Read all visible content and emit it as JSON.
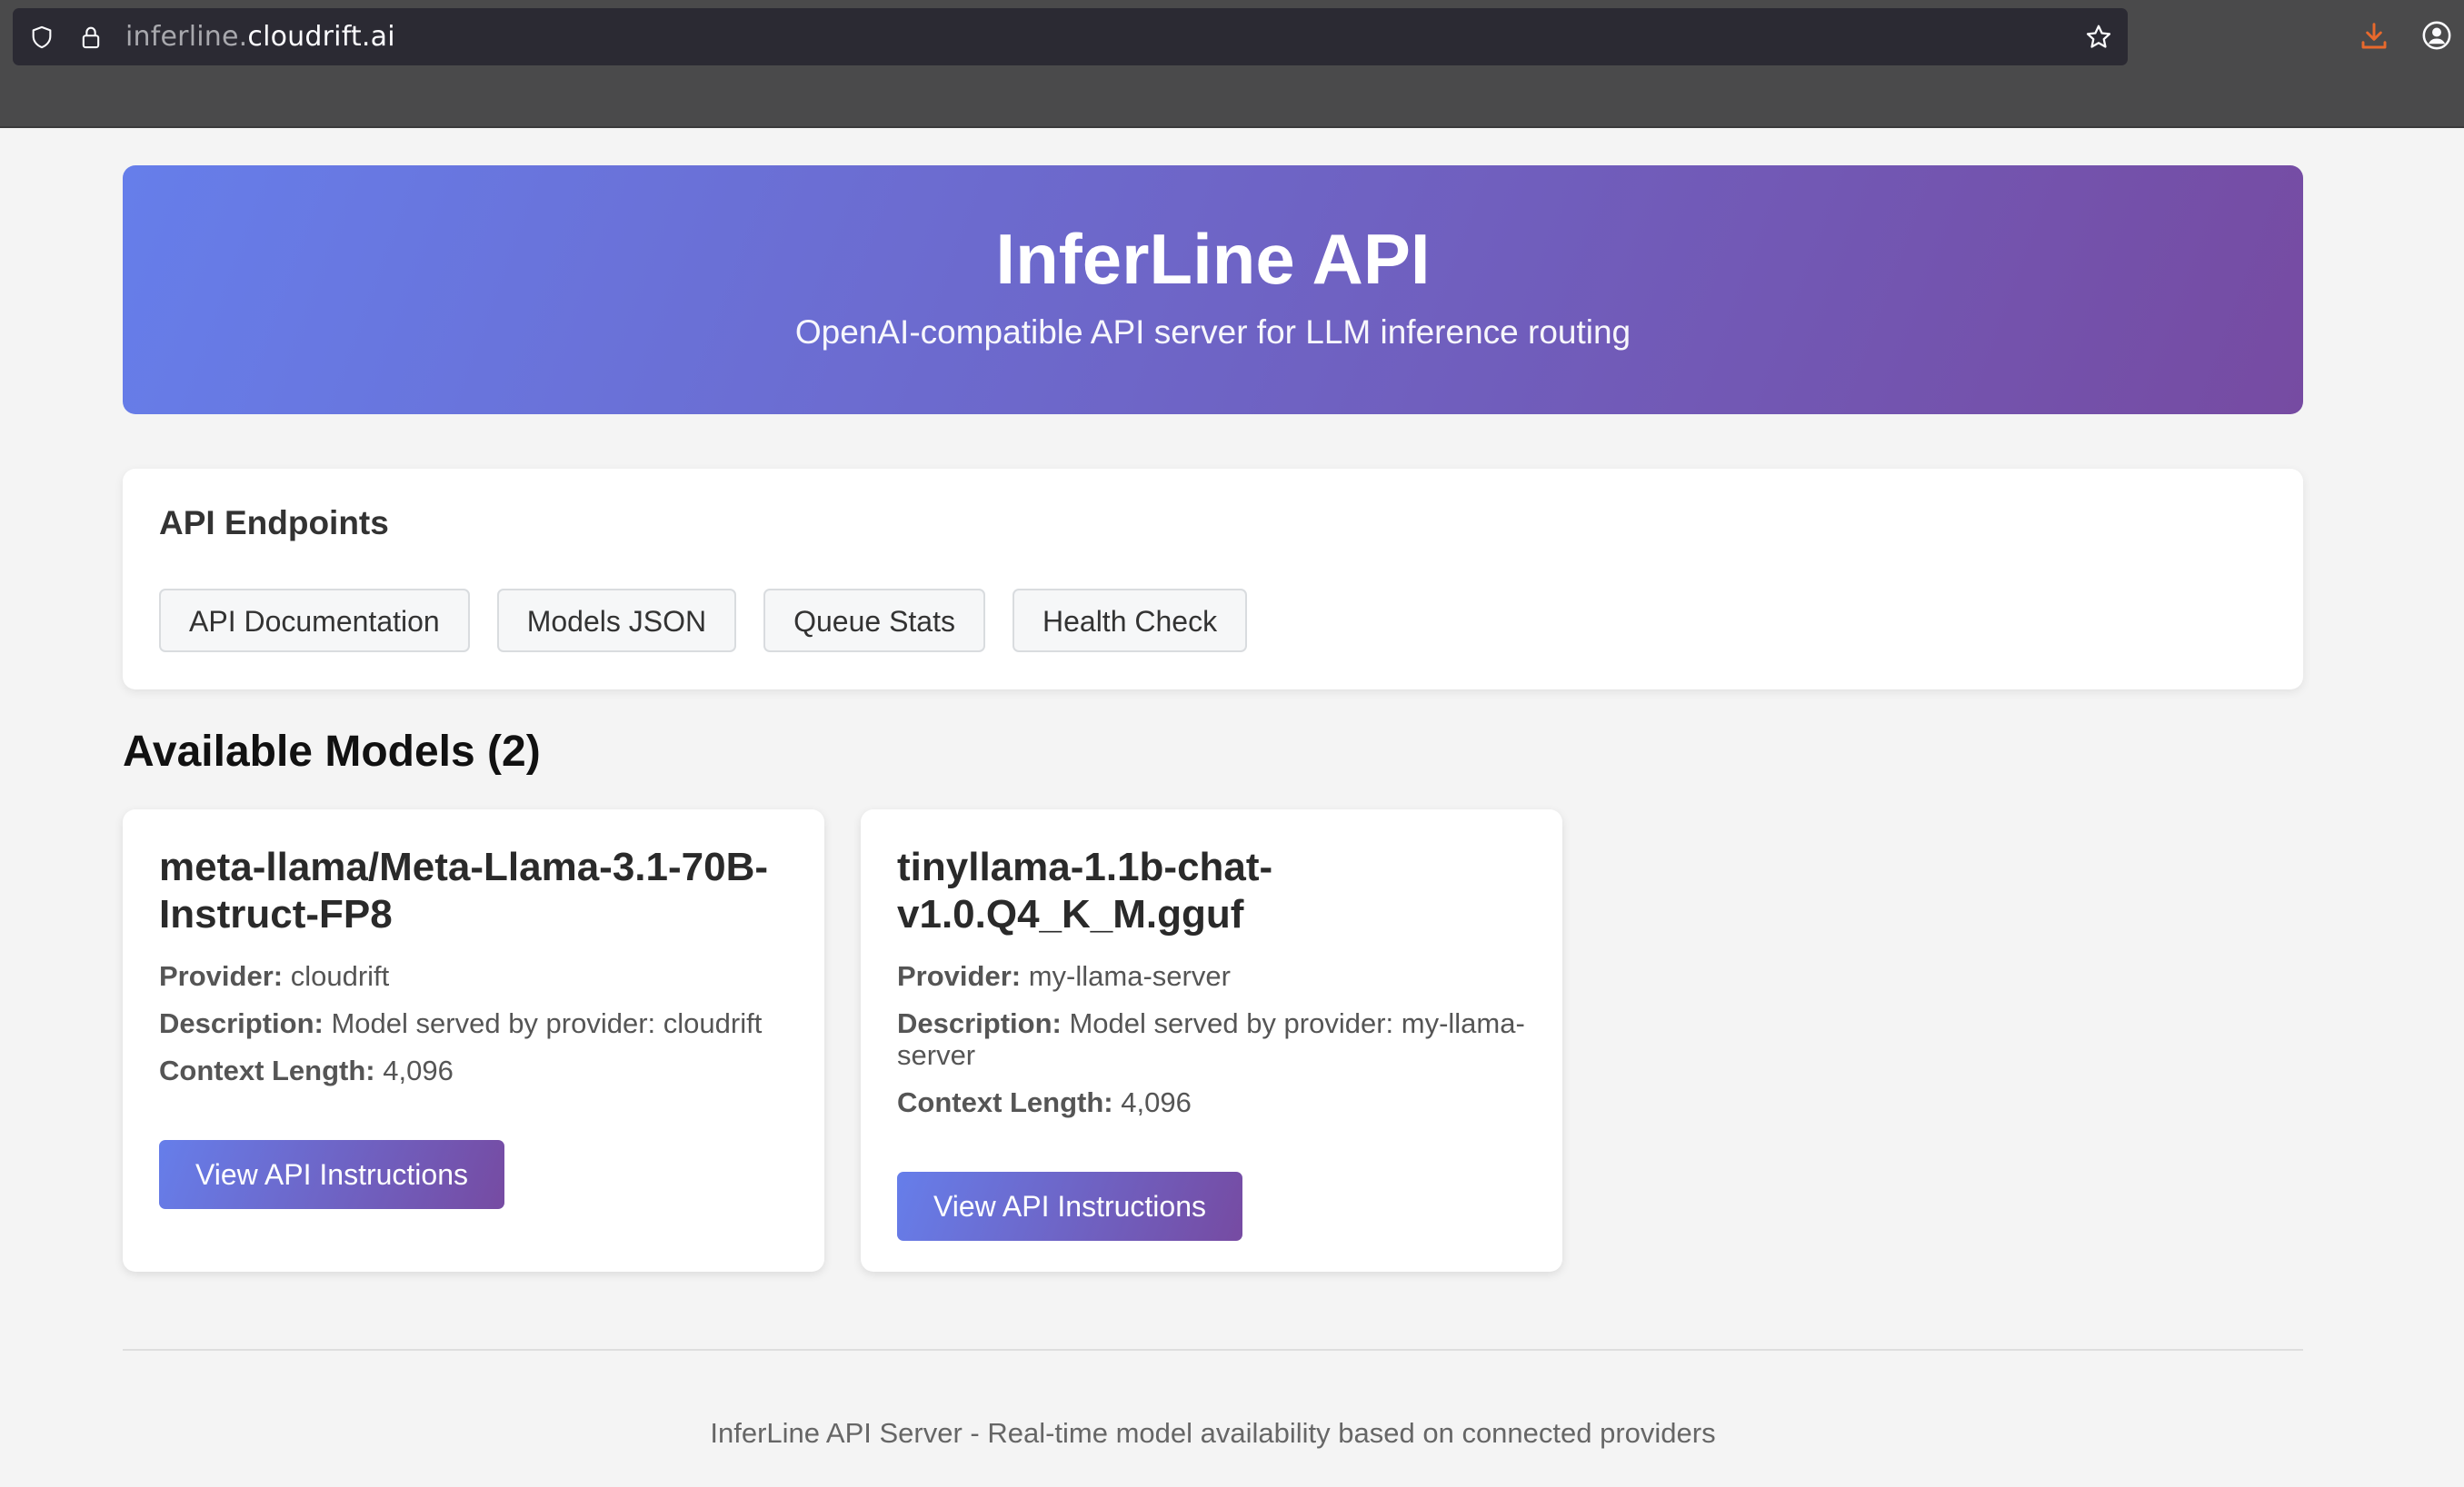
{
  "browser": {
    "url_sub": "inferline.",
    "url_main": "cloudrift.ai"
  },
  "hero": {
    "title": "InferLine API",
    "subtitle": "OpenAI-compatible API server for LLM inference routing"
  },
  "endpoints": {
    "title": "API Endpoints",
    "links": [
      {
        "label": "API Documentation"
      },
      {
        "label": "Models JSON"
      },
      {
        "label": "Queue Stats"
      },
      {
        "label": "Health Check"
      }
    ]
  },
  "models": {
    "heading": "Available Models (2)",
    "provider_label": "Provider:",
    "description_label": "Description:",
    "context_label": "Context Length:",
    "button_label": "View API Instructions",
    "items": [
      {
        "name": "meta-llama/Meta-Llama-3.1-70B-Instruct-FP8",
        "provider": "cloudrift",
        "description": "Model served by provider: cloudrift",
        "context_length": "4,096"
      },
      {
        "name": "tinyllama-1.1b-chat-v1.0.Q4_K_M.gguf",
        "provider": "my-llama-server",
        "description": "Model served by provider: my-llama-server",
        "context_length": "4,096"
      }
    ]
  },
  "footer": {
    "text": "InferLine API Server - Real-time model availability based on connected providers"
  },
  "colors": {
    "gradient_start": "#667eea",
    "gradient_end": "#764ba2",
    "page_background": "#f4f4f4",
    "download_icon": "#e8692c"
  },
  "icons": [
    "shield-icon",
    "lock-icon",
    "star-icon",
    "download-icon",
    "account-icon"
  ]
}
